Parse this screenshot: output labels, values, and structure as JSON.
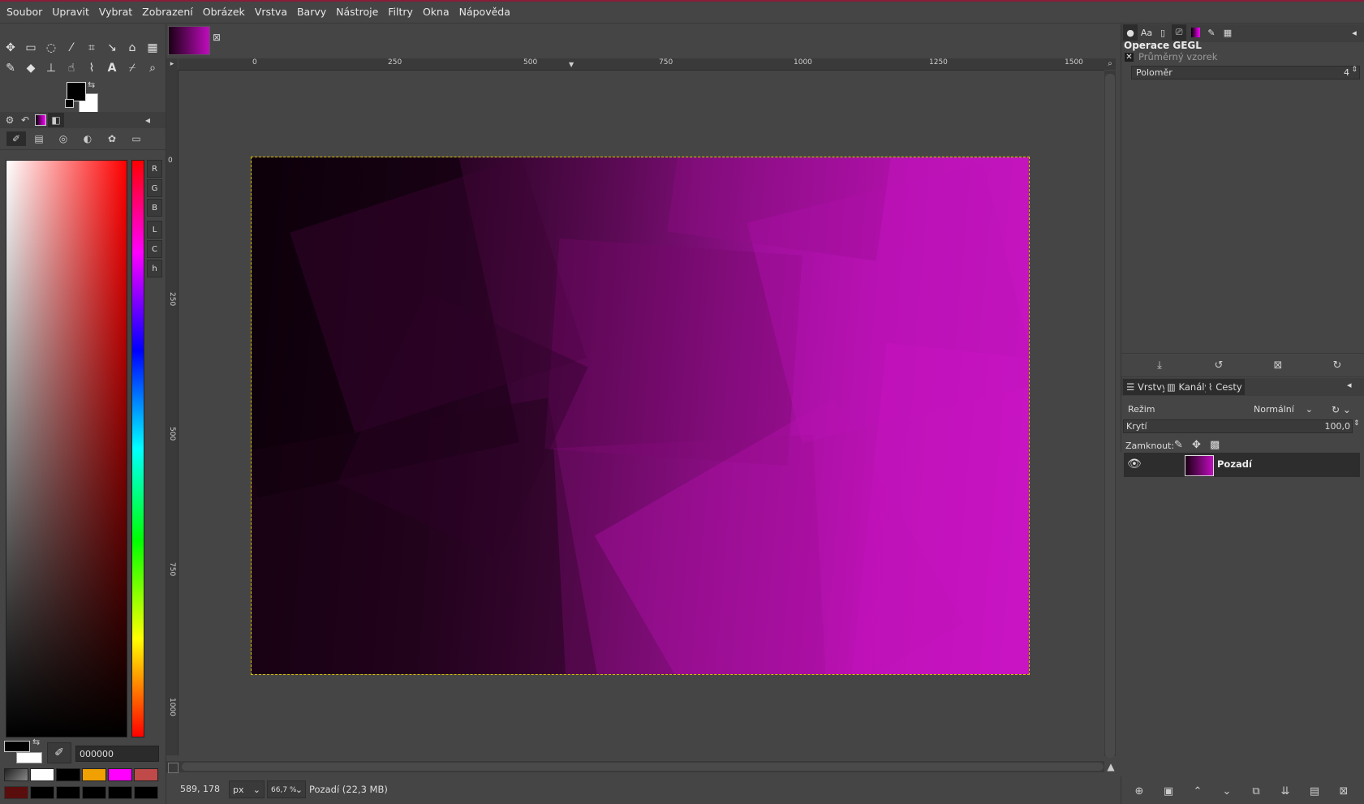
{
  "menubar": {
    "items": [
      "Soubor",
      "Upravit",
      "Vybrat",
      "Zobrazení",
      "Obrázek",
      "Vrstva",
      "Barvy",
      "Nástroje",
      "Filtry",
      "Okna",
      "Nápověda"
    ]
  },
  "toolbox": {
    "tools_row1": [
      "move-icon",
      "rect-select-icon",
      "lasso-icon",
      "fuzzy-select-icon",
      "crop-icon",
      "transform-icon",
      "warp-icon",
      "cage-icon"
    ],
    "tools_row2": [
      "paintbrush-icon",
      "eraser-icon",
      "clone-icon",
      "smudge-icon",
      "text-icon",
      "color-picker-icon",
      "zoom-icon"
    ],
    "channels": [
      "R",
      "G",
      "B",
      "L",
      "C",
      "h"
    ],
    "hex_value": "000000",
    "history_colors": [
      "#ffffff",
      "#000000",
      "#f0a000",
      "#ff00ff",
      "#c04a4a"
    ]
  },
  "canvas": {
    "ruler_top_labels": [
      "0",
      "250",
      "500",
      "750",
      "1000",
      "1250",
      "1500"
    ],
    "ruler_left_labels": [
      "0",
      "250",
      "500",
      "750",
      "1000"
    ]
  },
  "status": {
    "coords": "589, 178",
    "unit": "px",
    "zoom": "66,7 %",
    "layer_info": "Pozadí (22,3 MB)"
  },
  "gegl_panel": {
    "title": "Operace GEGL",
    "operation": "Průměrný vzorek",
    "param_label": "Poloměr",
    "param_value": "4"
  },
  "layers_panel": {
    "tabs": [
      "Vrstvy",
      "Kanály",
      "Cesty"
    ],
    "mode_label": "Režim",
    "mode_value": "Normální",
    "opacity_label": "Krytí",
    "opacity_value": "100,0",
    "lock_label": "Zamknout:",
    "layer_name": "Pozadí"
  },
  "colors": {
    "accent_magenta": "#c815c3",
    "bg_dark": "#454545"
  }
}
